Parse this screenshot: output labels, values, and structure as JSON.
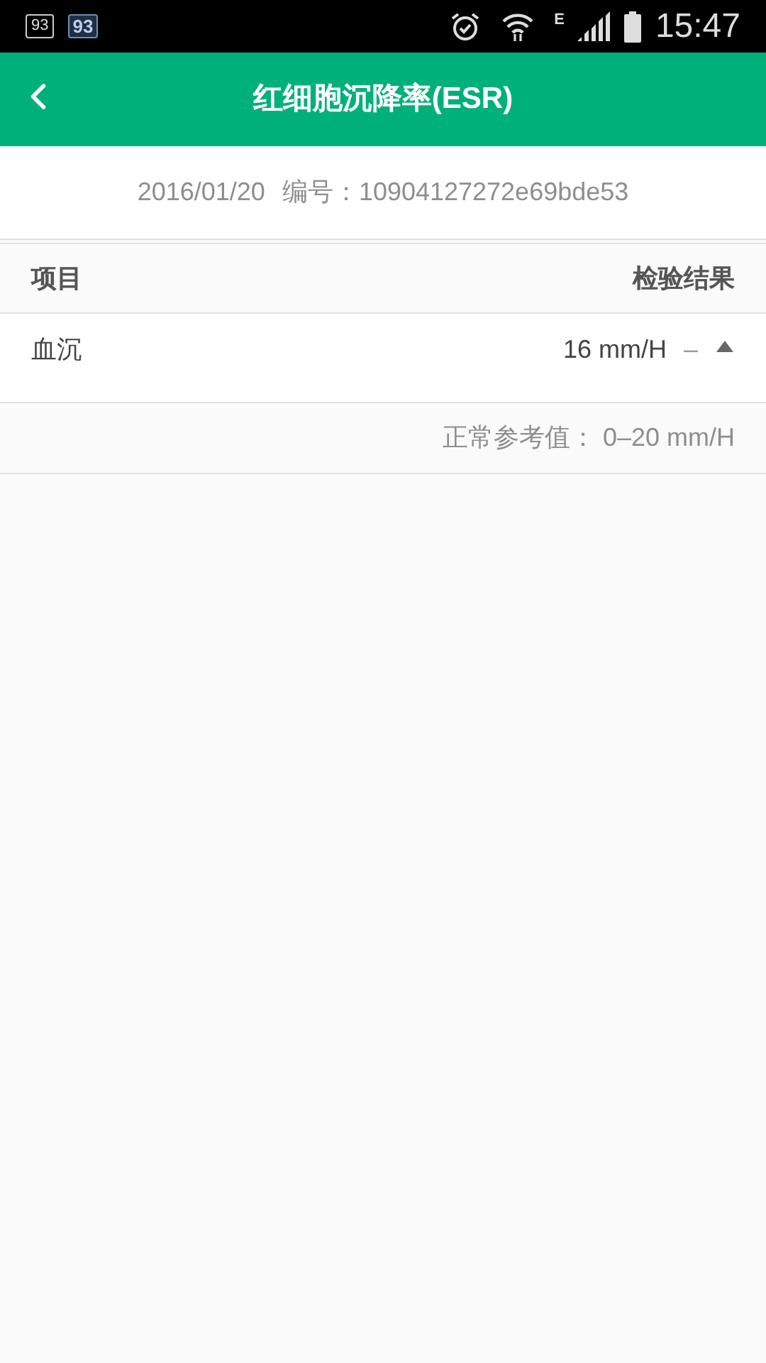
{
  "status_bar": {
    "notifications": [
      "93",
      "93"
    ],
    "network": "E",
    "time": "15:47"
  },
  "header": {
    "title": "红细胞沉降率(ESR)"
  },
  "report": {
    "date": "2016/01/20",
    "number_label": "编号：",
    "number": "10904127272e69bde53"
  },
  "table": {
    "columns": [
      "项目",
      "检验结果"
    ],
    "rows": [
      {
        "name": "血沉",
        "value": "16 mm/H",
        "flag": "–",
        "expanded": true,
        "reference": "正常参考值： 0–20 mm/H"
      }
    ]
  }
}
